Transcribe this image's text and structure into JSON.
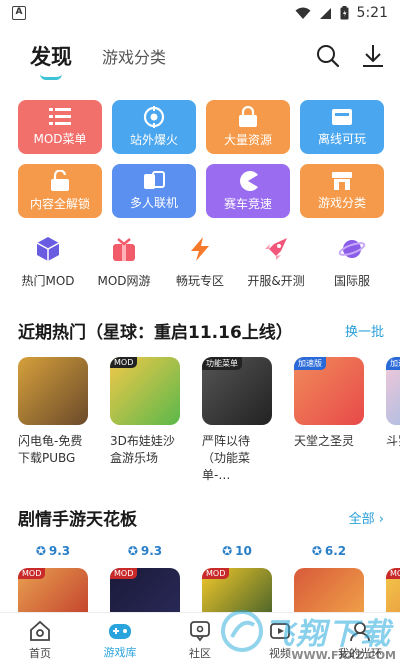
{
  "status_bar": {
    "time": "5:21"
  },
  "header": {
    "active_tab": "发现",
    "other_tab": "游戏分类"
  },
  "grid": [
    {
      "label": "MOD菜单",
      "color": "#f2706c",
      "icon": "list-icon"
    },
    {
      "label": "站外爆火",
      "color": "#4aa6ee",
      "icon": "target-icon"
    },
    {
      "label": "大量资源",
      "color": "#f59a4a",
      "icon": "lock-icon"
    },
    {
      "label": "离线可玩",
      "color": "#4aa6ee",
      "icon": "box-icon"
    },
    {
      "label": "内容全解锁",
      "color": "#f59a4a",
      "icon": "unlock-icon"
    },
    {
      "label": "多人联机",
      "color": "#5b8ff0",
      "icon": "cards-icon"
    },
    {
      "label": "赛车竞速",
      "color": "#9a6cf0",
      "icon": "pacman-icon"
    },
    {
      "label": "游戏分类",
      "color": "#f59a4a",
      "icon": "store-icon"
    }
  ],
  "categories": [
    {
      "label": "热门MOD",
      "icon": "cube-icon",
      "color": "#6a5ce0"
    },
    {
      "label": "MOD网游",
      "icon": "gift-icon",
      "color": "#f25c6a"
    },
    {
      "label": "畅玩专区",
      "icon": "bolt-icon",
      "color": "#f57a2c"
    },
    {
      "label": "开服&开测",
      "icon": "rocket-icon",
      "color": "#f2567a"
    },
    {
      "label": "国际服",
      "icon": "planet-icon",
      "color": "#8a5ce8"
    }
  ],
  "section1": {
    "title": "近期热门（星球：重启11.16上线）",
    "link": "换一批"
  },
  "hot_games": [
    {
      "name": "闪电龟-免费下载PUBG",
      "badge": "",
      "colors": [
        "#d6a03c",
        "#6a4a2a"
      ]
    },
    {
      "name": "3D布娃娃沙盒游乐场",
      "badge": "MOD",
      "colors": [
        "#f2c84a",
        "#5ab84a"
      ]
    },
    {
      "name": "严阵以待（功能菜单-…",
      "badge": "功能菜单",
      "colors": [
        "#555555",
        "#222222"
      ]
    },
    {
      "name": "天堂之圣灵",
      "badge": "加速版",
      "colors": [
        "#f08a5a",
        "#e84a4a"
      ]
    },
    {
      "name": "斗罗武魂",
      "badge": "加速版",
      "colors": [
        "#f4c8d8",
        "#8ab8e8"
      ]
    }
  ],
  "section2": {
    "title": "剧情手游天花板",
    "link": "全部"
  },
  "rated_games": [
    {
      "rating": "9.3",
      "badge": "MOD",
      "colors": [
        "#e8a050",
        "#c03a2a"
      ]
    },
    {
      "rating": "9.3",
      "badge": "MOD",
      "colors": [
        "#1a1a3a",
        "#2a2a5a"
      ]
    },
    {
      "rating": "10",
      "badge": "MOD",
      "colors": [
        "#f2c82a",
        "#3a5a2a"
      ]
    },
    {
      "rating": "6.2",
      "badge": "",
      "colors": [
        "#d85a3a",
        "#f2a84a"
      ]
    },
    {
      "rating": "",
      "badge": "MOD",
      "colors": [
        "#f2c84a",
        "#e87a3a"
      ]
    }
  ],
  "bottom_nav": [
    {
      "label": "首页",
      "icon": "home-icon",
      "active": false
    },
    {
      "label": "游戏库",
      "icon": "gamepad-icon",
      "active": true
    },
    {
      "label": "社区",
      "icon": "chat-icon",
      "active": false
    },
    {
      "label": "视频",
      "icon": "video-icon",
      "active": false
    },
    {
      "label": "我的光环",
      "icon": "profile-icon",
      "active": false
    }
  ],
  "watermark": {
    "text": "飞翔下载",
    "url": "WWW.FXXZ.COM"
  },
  "colors": {
    "accent": "#2aa4dc",
    "tab_underline": "#3ec3d6",
    "link": "#2a9fd8"
  }
}
